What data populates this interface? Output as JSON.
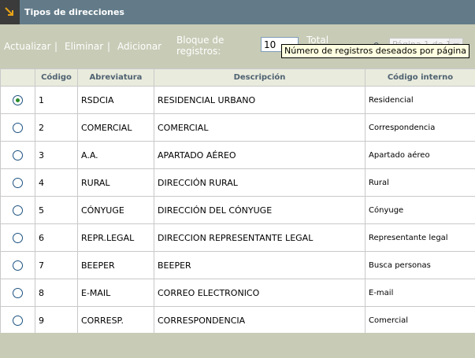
{
  "title": "Tipos de direcciones",
  "toolbar": {
    "actualizar": "Actualizar",
    "eliminar": "Eliminar",
    "adicionar": "Adicionar",
    "separator": "|",
    "bloque_line1": "Bloque de",
    "bloque_line2": "registros:",
    "registros_value": "10",
    "total_label": "Total",
    "total_partial": "9",
    "page_select_value": "Página 1 de 1"
  },
  "tooltip": "Número de registros deseados por página",
  "table": {
    "headers": [
      "Código",
      "Abreviatura",
      "Descripción",
      "Código interno"
    ],
    "rows": [
      {
        "codigo": "1",
        "abreviatura": "RSDCIA",
        "descripcion": "RESIDENCIAL URBANO",
        "interno": "Residencial",
        "selected": true
      },
      {
        "codigo": "2",
        "abreviatura": "COMERCIAL",
        "descripcion": "COMERCIAL",
        "interno": "Correspondencia",
        "selected": false
      },
      {
        "codigo": "3",
        "abreviatura": "A.A.",
        "descripcion": "APARTADO AÉREO",
        "interno": "Apartado aéreo",
        "selected": false
      },
      {
        "codigo": "4",
        "abreviatura": "RURAL",
        "descripcion": "DIRECCIÓN RURAL",
        "interno": "Rural",
        "selected": false
      },
      {
        "codigo": "5",
        "abreviatura": "CÓNYUGE",
        "descripcion": "DIRECCIÓN DEL CÓNYUGE",
        "interno": "Cónyuge",
        "selected": false
      },
      {
        "codigo": "6",
        "abreviatura": "REPR.LEGAL",
        "descripcion": "DIRECCION REPRESENTANTE LEGAL",
        "interno": "Representante legal",
        "selected": false
      },
      {
        "codigo": "7",
        "abreviatura": "BEEPER",
        "descripcion": "BEEPER",
        "interno": "Busca personas",
        "selected": false
      },
      {
        "codigo": "8",
        "abreviatura": "E-MAIL",
        "descripcion": "CORREO ELECTRONICO",
        "interno": "E-mail",
        "selected": false
      },
      {
        "codigo": "9",
        "abreviatura": "CORRESP.",
        "descripcion": "CORRESPONDENCIA",
        "interno": "Comercial",
        "selected": false
      }
    ]
  },
  "colors": {
    "titlebar": "#637B89",
    "toolbar": "#C8CBB6",
    "header_text": "#4F6271",
    "accent_icon": "#E8A317"
  },
  "icons": {
    "title": "arrow-down-right-icon",
    "radio": "radio-button-icon",
    "dropdown": "chevron-down-icon"
  }
}
